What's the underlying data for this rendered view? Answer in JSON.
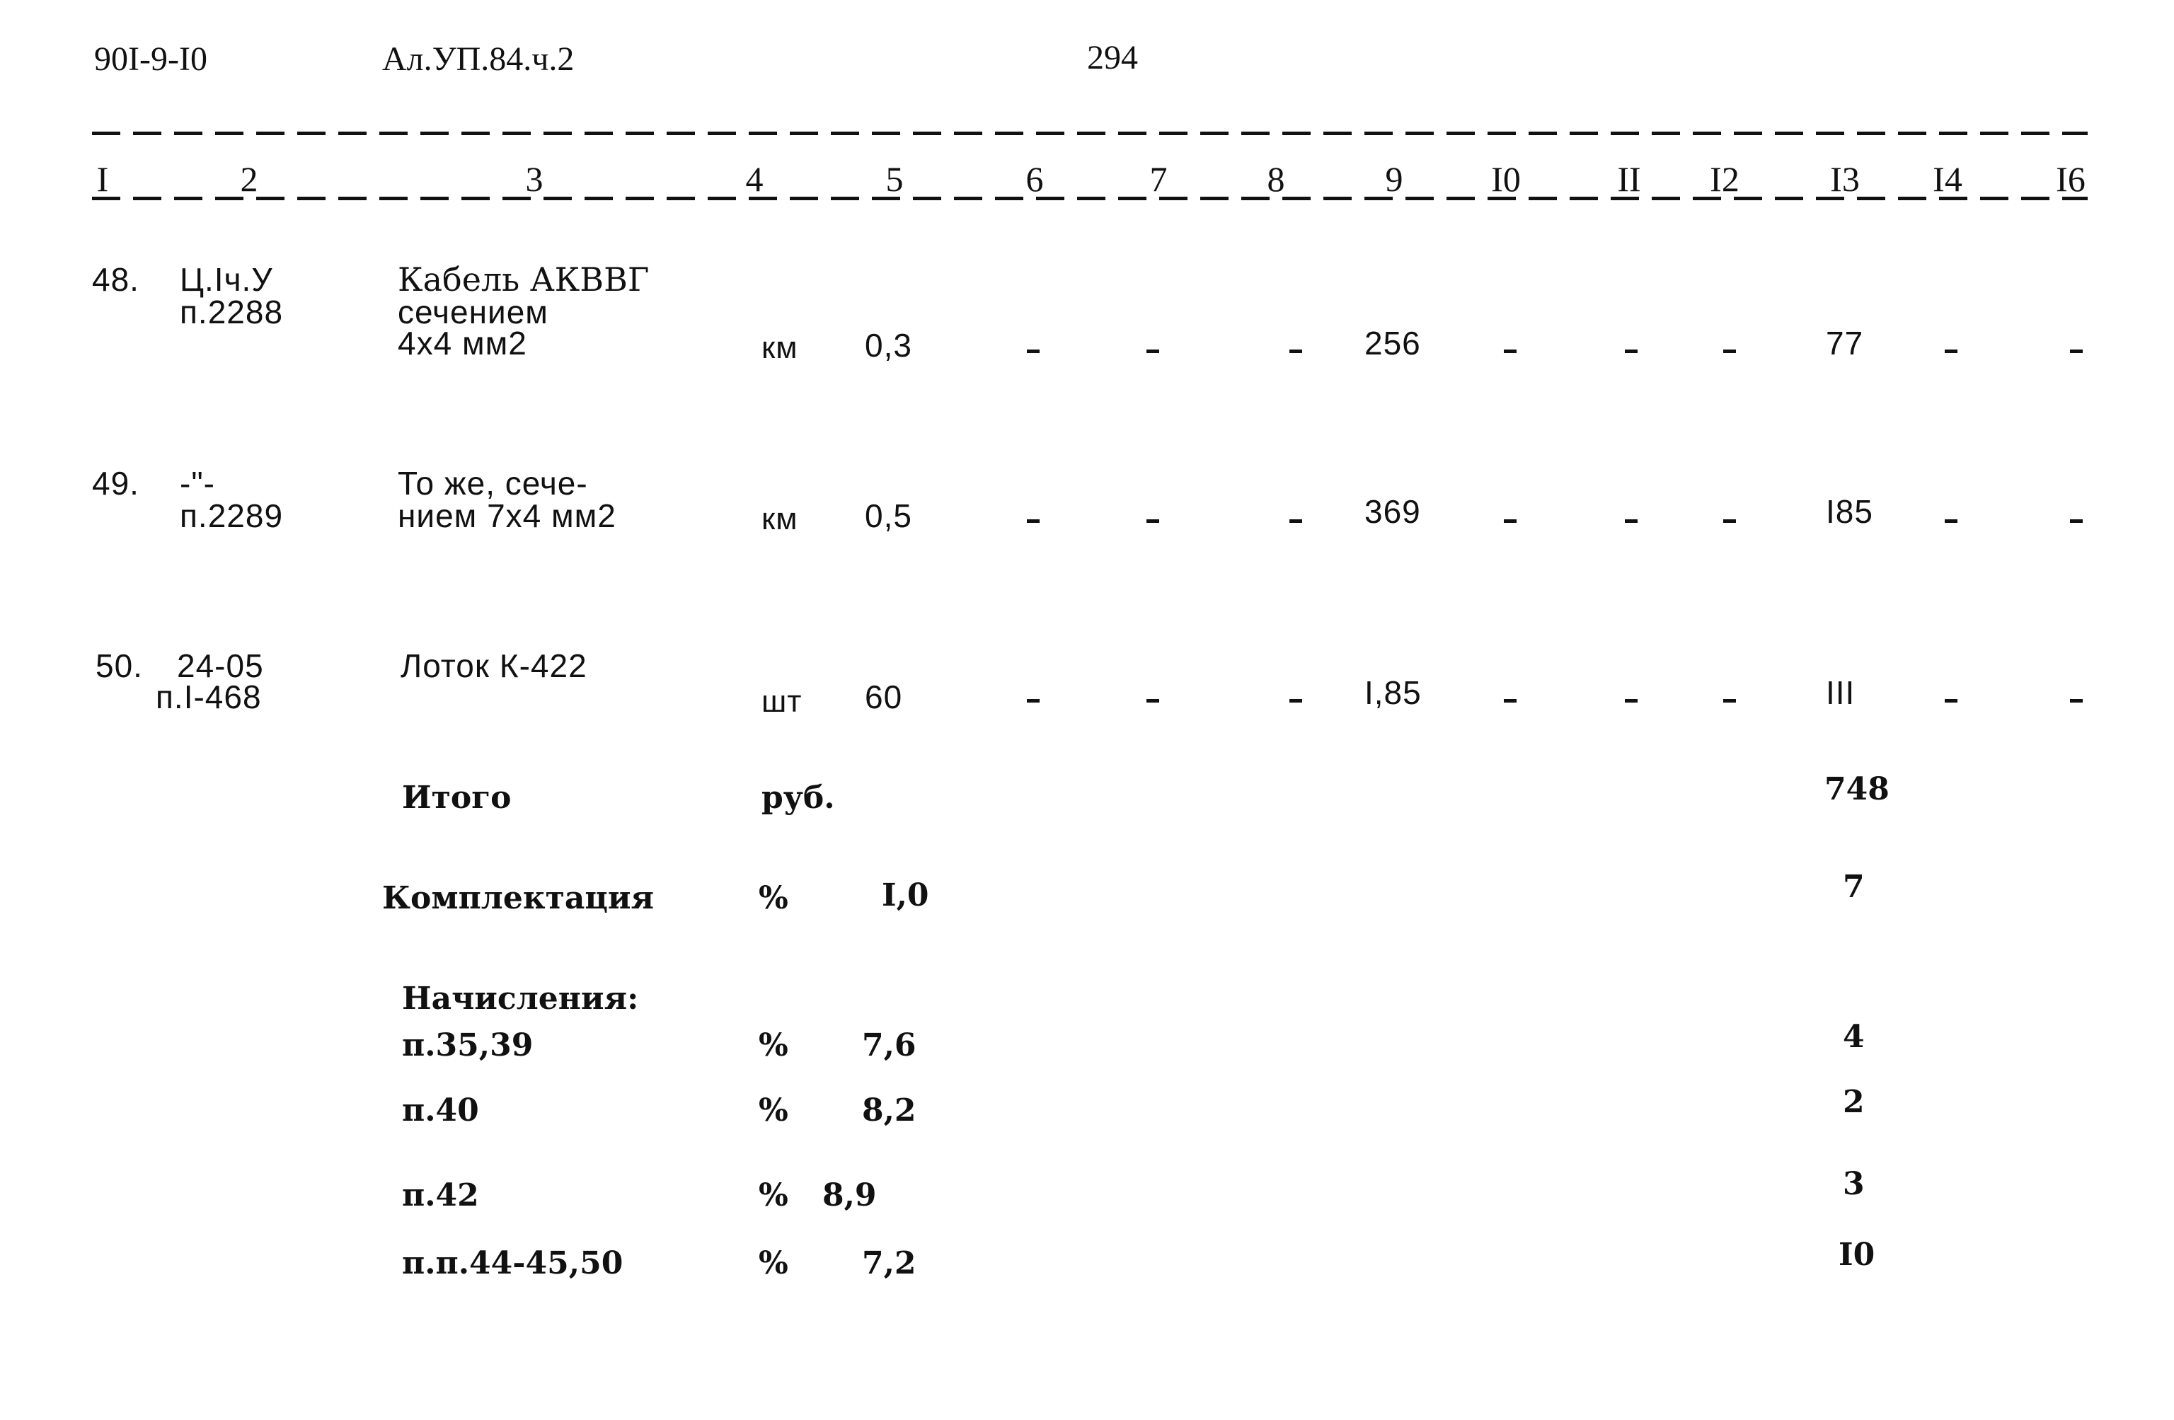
{
  "header": {
    "doc_code": "90I-9-I0",
    "album_ref": "Ал.УП.84.ч.2",
    "page_number": "294"
  },
  "columns": [
    "I",
    "2",
    "3",
    "4",
    "5",
    "6",
    "7",
    "8",
    "9",
    "I0",
    "II",
    "I2",
    "I3",
    "I4",
    "I6"
  ],
  "rows": [
    {
      "num": "48.",
      "code_line1": "Ц.Iч.У",
      "code_line2": "п.2288",
      "name_lines": [
        "Кабель АКВВГ",
        "сечением",
        "4х4 мм2"
      ],
      "unit": "км",
      "qty": "0,3",
      "c6": "-",
      "c7": "-",
      "c8": "-",
      "c9": "256",
      "c10": "-",
      "c11": "-",
      "c12": "-",
      "c13": "77",
      "c14": "-",
      "c16": "-"
    },
    {
      "num": "49.",
      "code_line1": "-\"-",
      "code_line2": "п.2289",
      "name_lines": [
        "То же, сече-",
        "нием 7х4 мм2"
      ],
      "unit": "км",
      "qty": "0,5",
      "c6": "-",
      "c7": "-",
      "c8": "-",
      "c9": "369",
      "c10": "-",
      "c11": "-",
      "c12": "-",
      "c13": "I85",
      "c14": "-",
      "c16": "-"
    },
    {
      "num": "50.",
      "code_line1": "24-05",
      "code_line2": "п.I-468",
      "name_lines": [
        "Лоток К-422"
      ],
      "unit": "шт",
      "qty": "60",
      "c6": "-",
      "c7": "-",
      "c8": "-",
      "c9": "I,85",
      "c10": "-",
      "c11": "-",
      "c12": "-",
      "c13": "III",
      "c14": "-",
      "c16": "-"
    }
  ],
  "summary": {
    "total": {
      "label": "Итого",
      "unit": "руб.",
      "value": "748"
    },
    "completion": {
      "label": "Комплектация",
      "unit": "%",
      "rate": "I,0",
      "value": "7"
    },
    "charges_heading": "Начисления:",
    "charges": [
      {
        "label": "п.35,39",
        "unit": "%",
        "rate": "7,6",
        "value": "4"
      },
      {
        "label": "п.40",
        "unit": "%",
        "rate": "8,2",
        "value": "2"
      },
      {
        "label": "п.42",
        "unit": "%",
        "rate": "8,9",
        "value": "3"
      },
      {
        "label": "п.п.44-45,50",
        "unit": "%",
        "rate": "7,2",
        "value": "I0"
      }
    ]
  }
}
